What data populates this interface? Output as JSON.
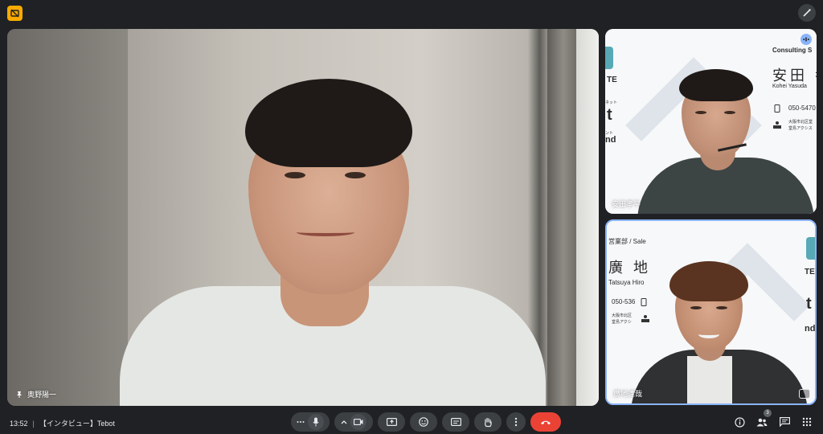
{
  "meeting": {
    "time": "13:52",
    "separator": "|",
    "title": "【インタビュー】Tebot"
  },
  "participants": {
    "main": {
      "name": "奥野陽一"
    },
    "side1": {
      "name": "安田孝平",
      "card": {
        "company_line": "Consulting S",
        "name_jp": "安田 孝",
        "name_en": "Kohei Yasuda",
        "phone": "050-5470",
        "address1": "大阪市北区堂",
        "address2": "堂島アクシス",
        "left_brand1": "TE",
        "left_brand2": "t",
        "left_brand3": "nd",
        "left_small1": "ネット",
        "left_small2": "ント"
      }
    },
    "side2": {
      "name": "廣地達哉",
      "card": {
        "dept": "営業部 / Sale",
        "name_jp": "廣 地",
        "name_en": "Tatsuya Hiro",
        "phone": "050-536",
        "address1": "大阪市北区",
        "address2": "堂島アクシ",
        "right_brand1": "TE",
        "right_brand2": "t",
        "right_brand3": "nd"
      }
    }
  },
  "people_badge": "3",
  "colors": {
    "background": "#202124",
    "control": "#3c4043",
    "end_call": "#ea4335",
    "app_icon": "#f9ab00",
    "active_border": "#8ab4f8"
  }
}
